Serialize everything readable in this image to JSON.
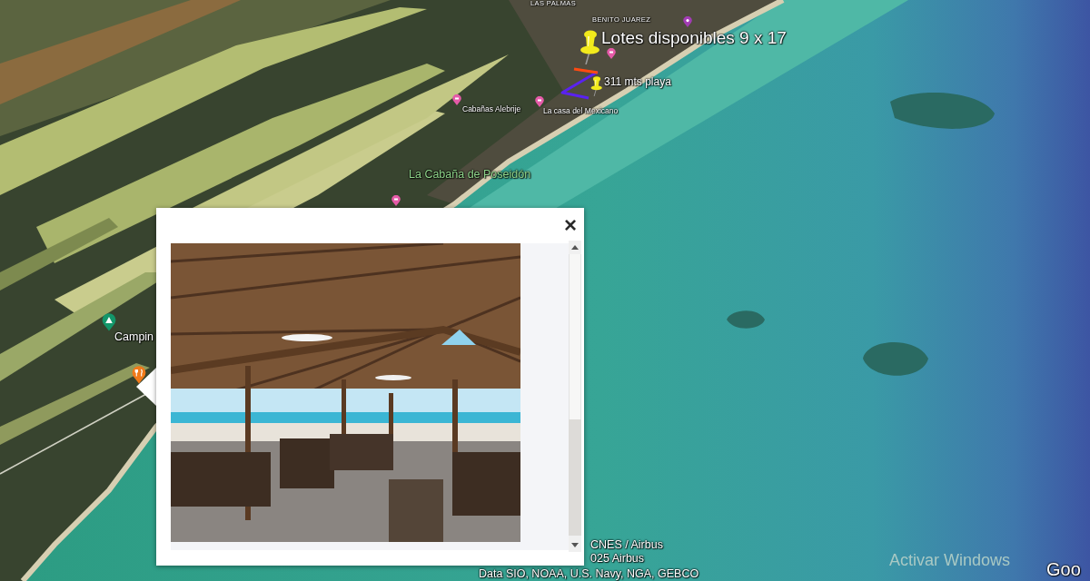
{
  "map": {
    "labels": [
      {
        "text": "LAS PALMAS",
        "kind": "locality"
      },
      {
        "text": "BENITO JUAREZ",
        "kind": "locality"
      },
      {
        "text": "Lotes disponibles 9 x 17",
        "kind": "placemark"
      },
      {
        "text": "311 mts playa",
        "kind": "placemark"
      },
      {
        "text": "Cabañas Alebrije",
        "kind": "poi"
      },
      {
        "text": "La casa del Mexicano",
        "kind": "poi"
      },
      {
        "text": "La Cabaña de Poseidón",
        "kind": "park"
      },
      {
        "text": "Campin",
        "kind": "poi"
      }
    ],
    "markers": [
      {
        "kind": "poi",
        "color": "#a23cb4"
      },
      {
        "kind": "pushpin",
        "color": "#f2ea1c"
      },
      {
        "kind": "hotel",
        "color": "#e55aa8"
      },
      {
        "kind": "pushpin",
        "color": "#f2ea1c"
      },
      {
        "kind": "hotel",
        "color": "#e55aa8"
      },
      {
        "kind": "hotel",
        "color": "#e55aa8"
      },
      {
        "kind": "hotel",
        "color": "#e55aa8"
      },
      {
        "kind": "camping",
        "color": "#13966a"
      },
      {
        "kind": "restaurant",
        "color": "#f07a1a"
      }
    ],
    "tracks": [
      {
        "color": "#5a22f0"
      },
      {
        "color": "#ff4a12"
      }
    ]
  },
  "popup": {
    "close": "×"
  },
  "attribution": [
    "CNES / Airbus",
    "025 Airbus",
    "Data SIO, NOAA, U.S. Navy, NGA, GEBCO"
  ],
  "os_notice": "Activar Windows",
  "logo": "Goo"
}
